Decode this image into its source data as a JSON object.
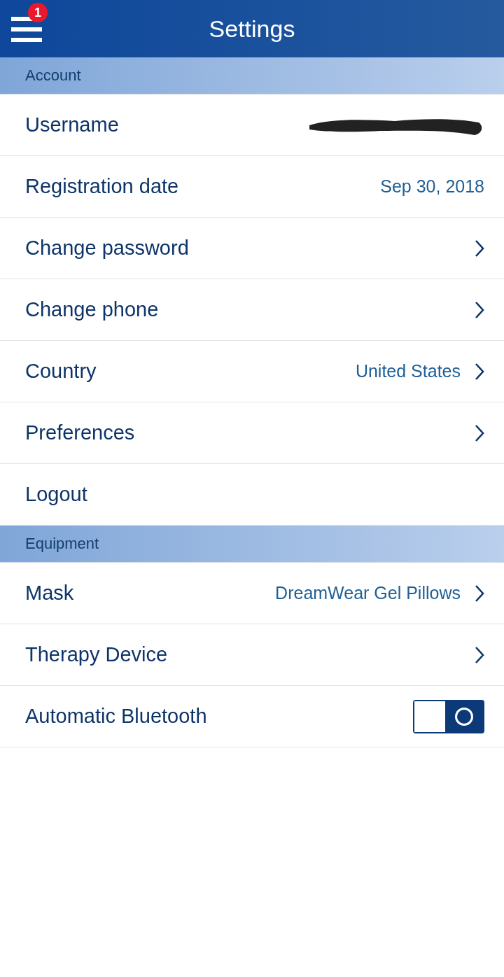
{
  "header": {
    "title": "Settings",
    "badge": "1"
  },
  "sections": [
    {
      "title": "Account",
      "rows": [
        {
          "kind": "redacted",
          "label": "Username"
        },
        {
          "kind": "value",
          "label": "Registration date",
          "value": "Sep 30, 2018"
        },
        {
          "kind": "link",
          "label": "Change password"
        },
        {
          "kind": "link",
          "label": "Change phone"
        },
        {
          "kind": "link",
          "label": "Country",
          "value": "United States"
        },
        {
          "kind": "link",
          "label": "Preferences"
        },
        {
          "kind": "plain",
          "label": "Logout"
        }
      ]
    },
    {
      "title": "Equipment",
      "rows": [
        {
          "kind": "link",
          "label": "Mask",
          "value": "DreamWear Gel Pillows"
        },
        {
          "kind": "link",
          "label": "Therapy Device"
        },
        {
          "kind": "toggle",
          "label": "Automatic Bluetooth",
          "on": false
        }
      ]
    }
  ]
}
